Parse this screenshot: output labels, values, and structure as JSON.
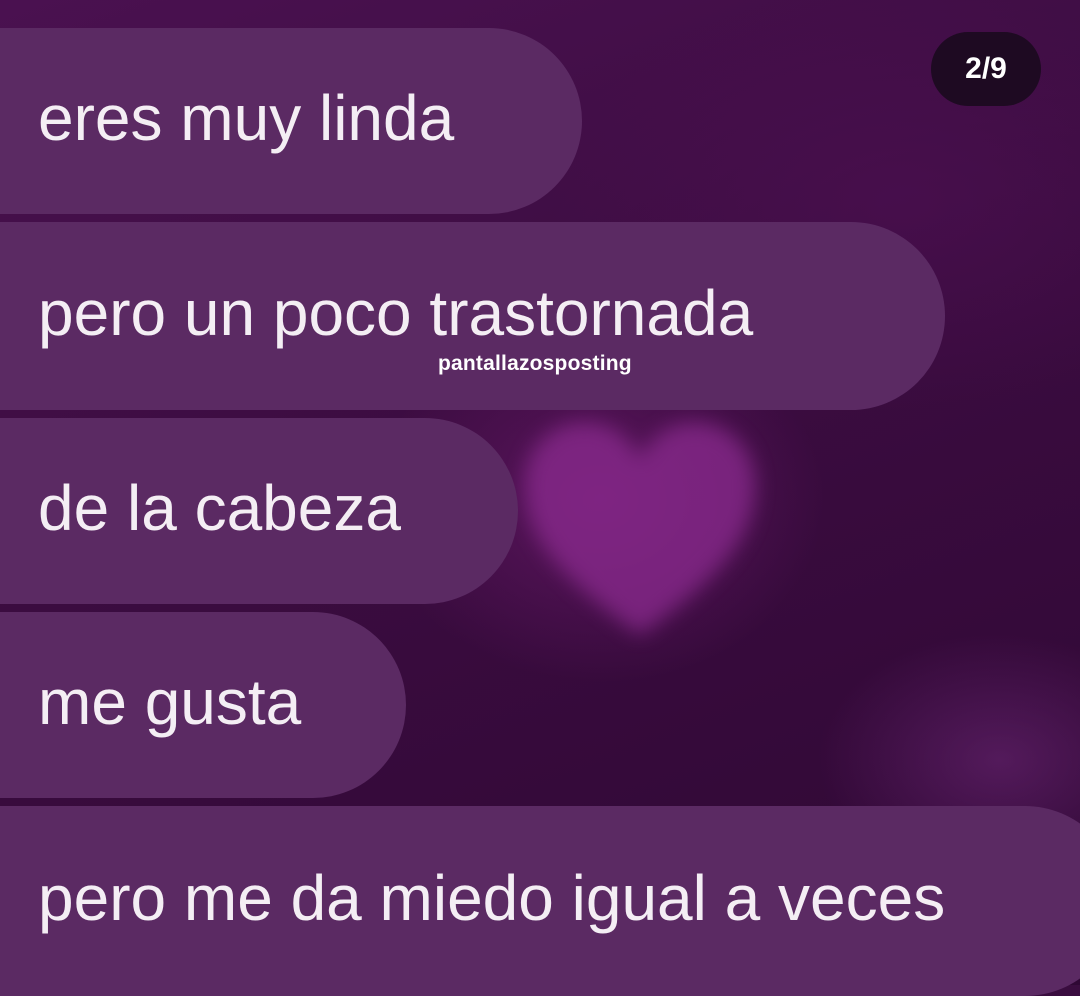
{
  "slide_counter": "2/9",
  "watermark": "pantallazosposting",
  "messages": [
    "eres muy linda",
    "pero un poco trastornada",
    "de la cabeza",
    "me gusta",
    "pero me da miedo igual a veces"
  ],
  "background_decoration": "heart-icon",
  "colors": {
    "bubble": "#5b2a63",
    "background": "#3a0d3f",
    "text": "#f4eef4",
    "counter_bg": "#1e0a22"
  }
}
